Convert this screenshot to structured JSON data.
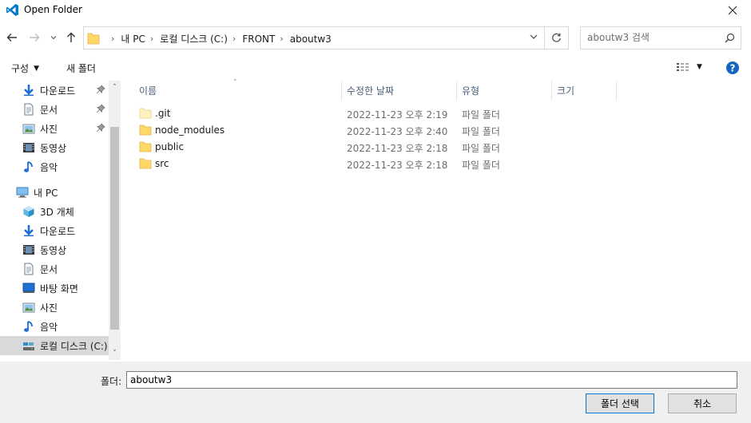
{
  "window": {
    "title": "Open Folder",
    "accent": "#007acc"
  },
  "address": {
    "crumbs": [
      "내 PC",
      "로컬 디스크 (C:)",
      "FRONT",
      "aboutw3"
    ]
  },
  "search": {
    "placeholder": "aboutw3 검색"
  },
  "commandbar": {
    "organize": "구성",
    "new_folder": "새 폴더"
  },
  "nav": {
    "items": [
      {
        "label": "다운로드",
        "icon": "download-icon"
      },
      {
        "label": "문서",
        "icon": "document-icon"
      },
      {
        "label": "사진",
        "icon": "pictures-icon"
      },
      {
        "label": "동영상",
        "icon": "videos-icon"
      },
      {
        "label": "음악",
        "icon": "music-icon"
      },
      {
        "label": "내 PC",
        "icon": "computer-icon"
      },
      {
        "label": "3D 개체",
        "icon": "3d-objects-icon"
      },
      {
        "label": "다운로드",
        "icon": "download-icon"
      },
      {
        "label": "동영상",
        "icon": "videos-icon"
      },
      {
        "label": "문서",
        "icon": "document-icon"
      },
      {
        "label": "바탕 화면",
        "icon": "desktop-icon"
      },
      {
        "label": "사진",
        "icon": "pictures-icon"
      },
      {
        "label": "음악",
        "icon": "music-icon"
      },
      {
        "label": "로컬 디스크 (C:)",
        "icon": "drive-icon"
      }
    ]
  },
  "columns": {
    "name": "이름",
    "date": "수정한 날짜",
    "type": "유형",
    "size": "크기"
  },
  "files": [
    {
      "name": ".git",
      "date": "2022-11-23 오후 2:19",
      "type": "파일 폴더"
    },
    {
      "name": "node_modules",
      "date": "2022-11-23 오후 2:40",
      "type": "파일 폴더"
    },
    {
      "name": "public",
      "date": "2022-11-23 오후 2:18",
      "type": "파일 폴더"
    },
    {
      "name": "src",
      "date": "2022-11-23 오후 2:18",
      "type": "파일 폴더"
    }
  ],
  "footer": {
    "folder_label": "폴더:",
    "folder_value": "aboutw3",
    "select_button": "폴더 선택",
    "cancel_button": "취소"
  }
}
